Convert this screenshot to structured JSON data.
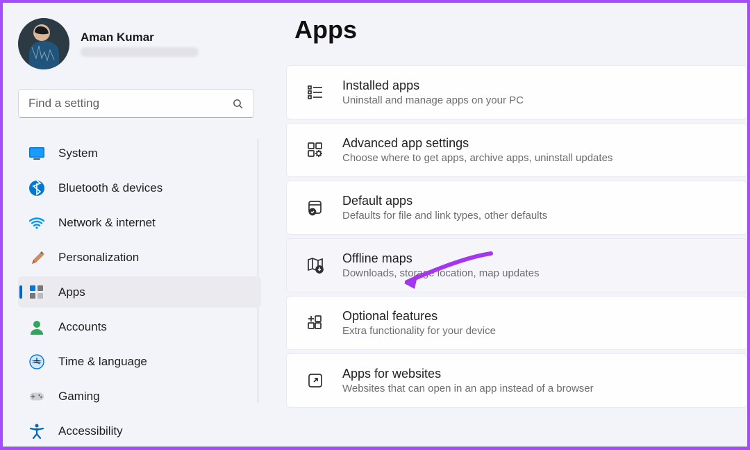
{
  "profile": {
    "name": "Aman Kumar"
  },
  "search": {
    "placeholder": "Find a setting"
  },
  "sidebar": {
    "items": [
      {
        "label": "System"
      },
      {
        "label": "Bluetooth & devices"
      },
      {
        "label": "Network & internet"
      },
      {
        "label": "Personalization"
      },
      {
        "label": "Apps"
      },
      {
        "label": "Accounts"
      },
      {
        "label": "Time & language"
      },
      {
        "label": "Gaming"
      },
      {
        "label": "Accessibility"
      }
    ],
    "selected": "Apps"
  },
  "main": {
    "title": "Apps",
    "cards": [
      {
        "title": "Installed apps",
        "subtitle": "Uninstall and manage apps on your PC"
      },
      {
        "title": "Advanced app settings",
        "subtitle": "Choose where to get apps, archive apps, uninstall updates"
      },
      {
        "title": "Default apps",
        "subtitle": "Defaults for file and link types, other defaults"
      },
      {
        "title": "Offline maps",
        "subtitle": "Downloads, storage location, map updates",
        "highlight": true
      },
      {
        "title": "Optional features",
        "subtitle": "Extra functionality for your device"
      },
      {
        "title": "Apps for websites",
        "subtitle": "Websites that can open in an app instead of a browser"
      }
    ]
  },
  "annotation": {
    "arrow_color": "#a436ef",
    "target": "Offline maps"
  }
}
